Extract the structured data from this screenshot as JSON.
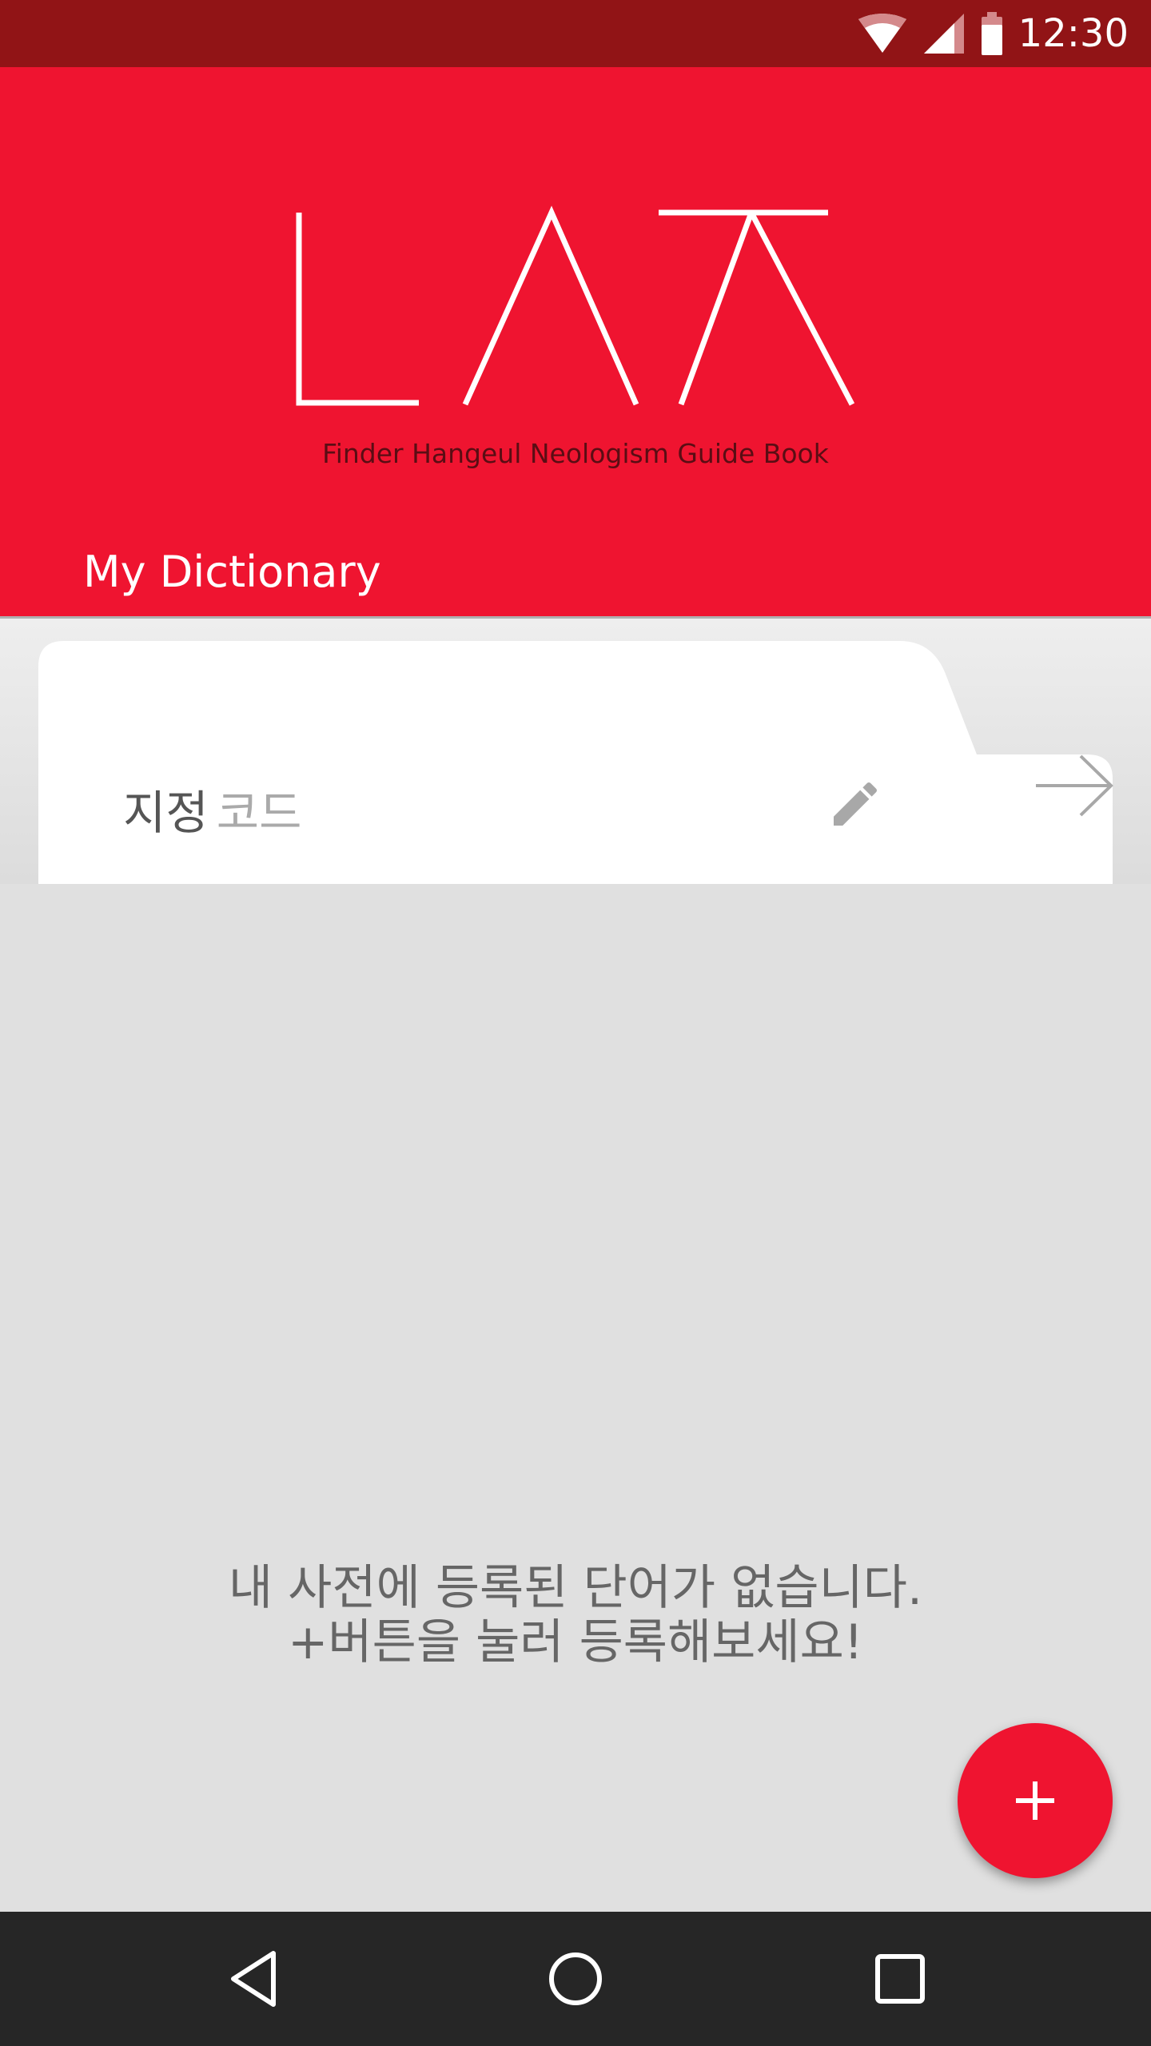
{
  "status_bar": {
    "time": "12:30",
    "icons": [
      "wifi-icon",
      "signal-icon",
      "battery-icon"
    ]
  },
  "header": {
    "logo_name": "Finder Hangeul logo",
    "tagline": "Finder Hangeul Neologism Guide Book",
    "section_title": "My Dictionary"
  },
  "tab": {
    "label_main": "지정",
    "label_sub": "코드",
    "edit_icon": "pencil-icon",
    "next_icon": "arrow-right-icon"
  },
  "empty_state": {
    "line1": "내 사전에 등록된 단어가 없습니다.",
    "line2": "+버튼을 눌러 등록해보세요!"
  },
  "fab": {
    "icon": "plus-icon"
  },
  "nav_bar": {
    "buttons": [
      "back-icon",
      "home-icon",
      "recents-icon"
    ]
  },
  "colors": {
    "status_bar": "#911416",
    "brand_red": "#ef1430",
    "background": "#e0e0e0",
    "nav_bar": "#262626"
  }
}
